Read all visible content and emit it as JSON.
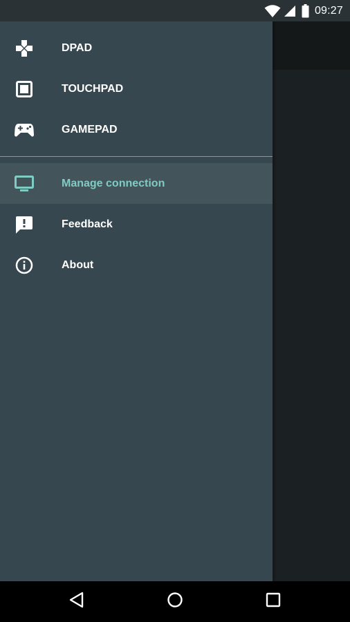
{
  "status_bar": {
    "time": "09:27",
    "icons": [
      "wifi-icon",
      "cell-signal-icon",
      "battery-icon"
    ]
  },
  "drawer": {
    "primary_items": [
      {
        "label": "DPAD",
        "icon": "dpad-icon"
      },
      {
        "label": "TOUCHPAD",
        "icon": "touchpad-icon"
      },
      {
        "label": "GAMEPAD",
        "icon": "gamepad-icon"
      }
    ],
    "secondary_items": [
      {
        "label": "Manage connection",
        "icon": "tv-icon",
        "active": true
      },
      {
        "label": "Feedback",
        "icon": "feedback-icon"
      },
      {
        "label": "About",
        "icon": "info-icon"
      }
    ]
  },
  "nav_bar": {
    "buttons": [
      "back-icon",
      "home-icon",
      "recents-icon"
    ]
  },
  "colors": {
    "drawer_bg": "#37474f",
    "active_bg": "#43545b",
    "accent": "#80cbc4",
    "status_bar_bg": "#2a3236",
    "nav_bar_bg": "#000000"
  }
}
